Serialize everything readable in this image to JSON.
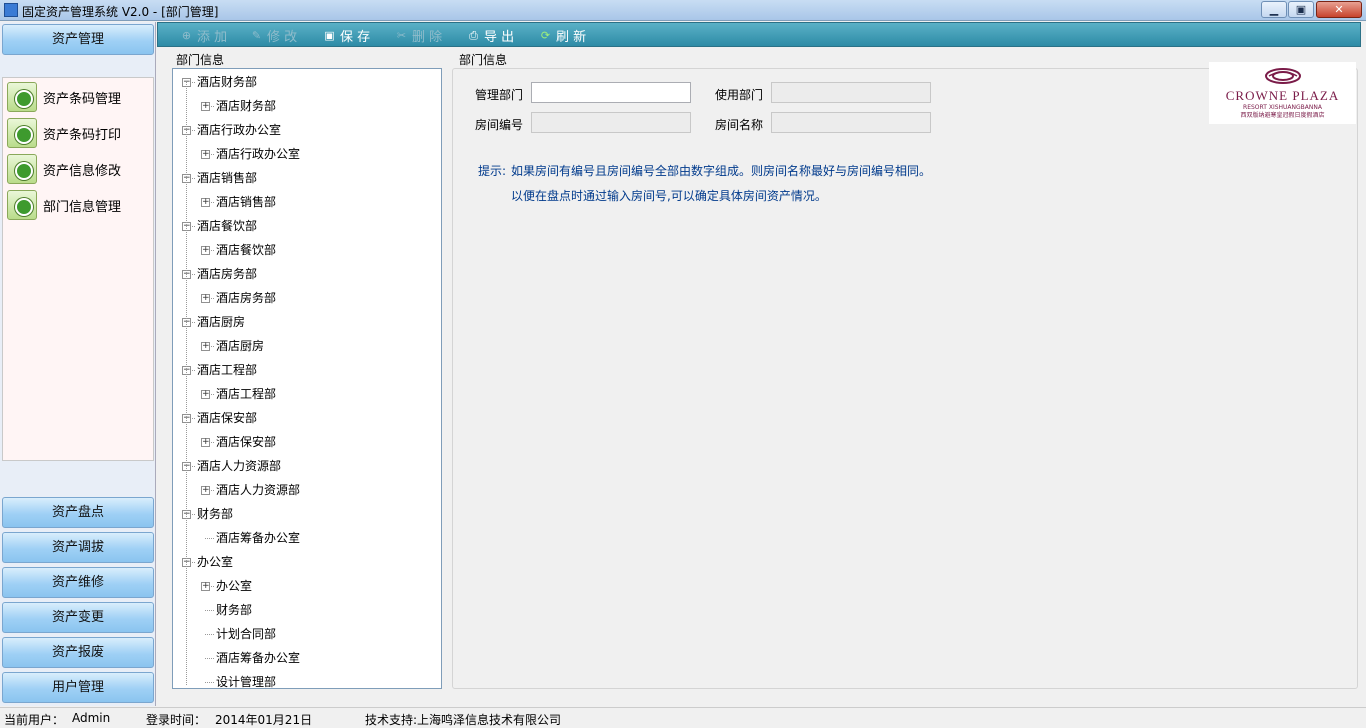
{
  "window": {
    "title": "固定资产管理系统 V2.0 - [部门管理]"
  },
  "leftnav": {
    "top_label": "资产管理",
    "items": [
      "资产条码管理",
      "资产条码打印",
      "资产信息修改",
      "部门信息管理"
    ],
    "bottom_buttons": [
      "资产盘点",
      "资产调拔",
      "资产维修",
      "资产变更",
      "资产报废",
      "用户管理"
    ]
  },
  "toolbar": {
    "add": "添 加",
    "edit": "修 改",
    "save": "保 存",
    "delete": "删 除",
    "export": "导 出",
    "refresh": "刷 新"
  },
  "tree": {
    "group_label": "部门信息",
    "nodes": [
      {
        "label": "酒店财务部",
        "level": 0,
        "expander": "⊟"
      },
      {
        "label": "酒店财务部",
        "level": 1,
        "expander": "⊞"
      },
      {
        "label": "酒店行政办公室",
        "level": 0,
        "expander": "⊟"
      },
      {
        "label": "酒店行政办公室",
        "level": 1,
        "expander": "⊞"
      },
      {
        "label": "酒店销售部",
        "level": 0,
        "expander": "⊟"
      },
      {
        "label": "酒店销售部",
        "level": 1,
        "expander": "⊞"
      },
      {
        "label": "酒店餐饮部",
        "level": 0,
        "expander": "⊟"
      },
      {
        "label": "酒店餐饮部",
        "level": 1,
        "expander": "⊞"
      },
      {
        "label": "酒店房务部",
        "level": 0,
        "expander": "⊟"
      },
      {
        "label": "酒店房务部",
        "level": 1,
        "expander": "⊞"
      },
      {
        "label": "酒店厨房",
        "level": 0,
        "expander": "⊟"
      },
      {
        "label": "酒店厨房",
        "level": 1,
        "expander": "⊞"
      },
      {
        "label": "酒店工程部",
        "level": 0,
        "expander": "⊟"
      },
      {
        "label": "酒店工程部",
        "level": 1,
        "expander": "⊞"
      },
      {
        "label": "酒店保安部",
        "level": 0,
        "expander": "⊟"
      },
      {
        "label": "酒店保安部",
        "level": 1,
        "expander": "⊞"
      },
      {
        "label": "酒店人力资源部",
        "level": 0,
        "expander": "⊟"
      },
      {
        "label": "酒店人力资源部",
        "level": 1,
        "expander": "⊞"
      },
      {
        "label": "财务部",
        "level": 0,
        "expander": "⊟"
      },
      {
        "label": "酒店筹备办公室",
        "level": 1,
        "expander": ""
      },
      {
        "label": "办公室",
        "level": 0,
        "expander": "⊟"
      },
      {
        "label": "办公室",
        "level": 1,
        "expander": "⊞"
      },
      {
        "label": "财务部",
        "level": 1,
        "expander": ""
      },
      {
        "label": "计划合同部",
        "level": 1,
        "expander": ""
      },
      {
        "label": "酒店筹备办公室",
        "level": 1,
        "expander": ""
      },
      {
        "label": "设计管理部",
        "level": 1,
        "expander": ""
      }
    ]
  },
  "detail": {
    "group_label": "部门信息",
    "mgmt_dept_label": "管理部门",
    "mgmt_dept_value": "",
    "use_dept_label": "使用部门",
    "use_dept_value": "",
    "room_no_label": "房间编号",
    "room_no_value": "",
    "room_name_label": "房间名称",
    "room_name_value": "",
    "tip_prefix": "提示:",
    "tip_line1": "如果房间有编号且房间编号全部由数字组成。则房间名称最好与房间编号相同。",
    "tip_line2": "以便在盘点时通过输入房间号,可以确定具体房间资产情况。"
  },
  "logo": {
    "brand": "CROWNE PLAZA",
    "sub": "RESORT XISHUANGBANNA",
    "cn": "西双版纳避寒皇冠假日度假酒店",
    "color": "#7a1b48"
  },
  "status": {
    "user_label": "当前用户：",
    "user_value": "Admin",
    "login_label": "登录时间：",
    "login_value": "2014年01月21日",
    "support": "技术支持:上海鸣泽信息技术有限公司"
  }
}
